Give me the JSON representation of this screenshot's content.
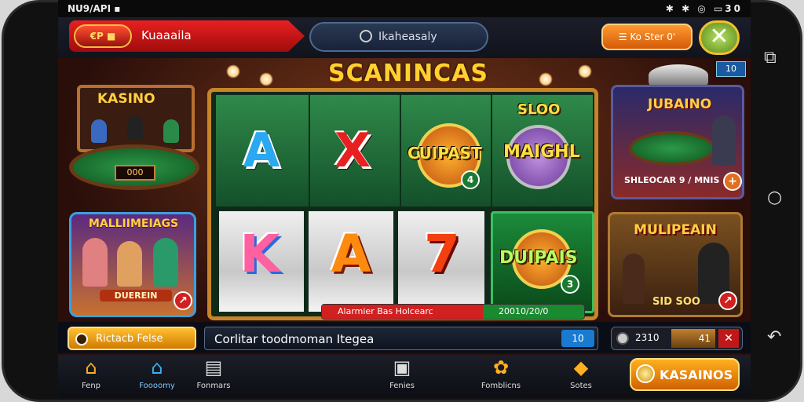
{
  "status_bar": {
    "left": "NU9/API ▪",
    "right": "✱ ✱ ◎ ▭30"
  },
  "header": {
    "brand_logo": "€P ■",
    "brand_title": "Kuaaaila",
    "search_text": "Ikaheasaly",
    "orange_pill": "☰ Ko Ster 0'",
    "star_button": "✕",
    "corner_tag": "10"
  },
  "hero": {
    "title": "SCANINCAS"
  },
  "left_scene": {
    "sign": "KASINO",
    "table_counter": "000"
  },
  "left_card": {
    "title": "MALLIIMEIAGS",
    "subtitle": "DUEREIN"
  },
  "slot": {
    "top_row": [
      "A",
      "X"
    ],
    "word_1": "CUIPAST",
    "badge_1": "4",
    "word_2": "MAIGHL",
    "word_2_top": "SLOO",
    "bottom_row": [
      "K",
      "A",
      "7"
    ],
    "green_word": "DUIPAIS",
    "badge_2": "3",
    "win_strip_left": "Alarmier Bas Holcearc",
    "win_strip_right": "20010/20/0"
  },
  "right_card_1": {
    "title": "JUBAINO",
    "subtitle": "SHLEOCAR 9 / MNIS"
  },
  "right_card_2": {
    "title": "MULIPEAIN",
    "subtitle": "SID SOO"
  },
  "controls": {
    "yellow_button": "Rictacb Felse",
    "marquee": "Corlitar toodmoman Itegea",
    "marquee_badge": "10",
    "bet_value": "2310",
    "bet_mid": "41",
    "bet_close": "✕"
  },
  "nav": [
    {
      "label": "Fenp",
      "icon": "⌂"
    },
    {
      "label": "Foooomy",
      "icon": "⌂"
    },
    {
      "label": "Fonmars",
      "icon": "▤"
    },
    {
      "label": "Fenies",
      "icon": "▣"
    },
    {
      "label": "Fomblicns",
      "icon": "✿"
    },
    {
      "label": "Sotes",
      "icon": "◆"
    }
  ],
  "kasinos_button": "KASAINOS",
  "colors": {
    "accent_red": "#e82020",
    "accent_orange": "#f08020",
    "felt_green": "#2f8a4a",
    "gold": "#ffd030"
  }
}
